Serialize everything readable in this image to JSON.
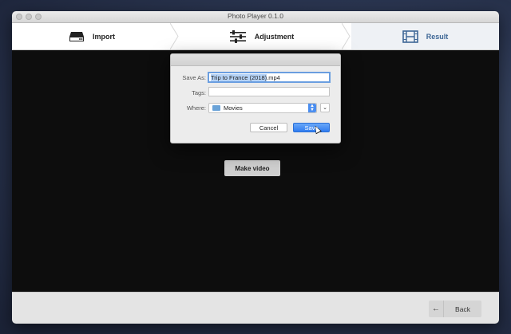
{
  "window": {
    "title": "Photo Player 0.1.0"
  },
  "steps": [
    {
      "label": "Import",
      "icon": "drive-icon"
    },
    {
      "label": "Adjustment",
      "icon": "sliders-icon"
    },
    {
      "label": "Result",
      "icon": "film-icon"
    }
  ],
  "content": {
    "make_video_label": "Make video"
  },
  "footer": {
    "back_label": "Back",
    "back_icon": "arrow-left-icon"
  },
  "save_dialog": {
    "save_as_label": "Save As:",
    "filename_selected": "Trip to France (2018)",
    "filename_ext": ".mp4",
    "tags_label": "Tags:",
    "tags_value": "",
    "where_label": "Where:",
    "where_value": "Movies",
    "cancel_label": "Cancel",
    "save_label": "Save"
  },
  "colors": {
    "accent": "#3e6796",
    "primary_button": "#2f7cf0"
  }
}
